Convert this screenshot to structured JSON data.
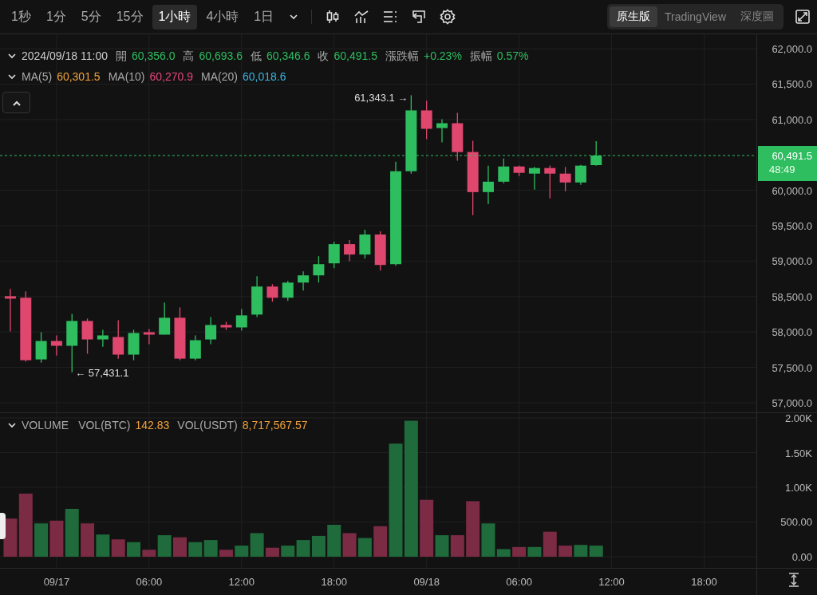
{
  "toolbar": {
    "intervals": [
      {
        "label": "1秒",
        "selected": false
      },
      {
        "label": "1分",
        "selected": false
      },
      {
        "label": "5分",
        "selected": false
      },
      {
        "label": "15分",
        "selected": false
      },
      {
        "label": "1小時",
        "selected": true
      },
      {
        "label": "4小時",
        "selected": false
      },
      {
        "label": "1日",
        "selected": false
      }
    ],
    "views": [
      {
        "label": "原生版",
        "selected": true
      },
      {
        "label": "TradingView",
        "selected": false
      },
      {
        "label": "深度圖",
        "selected": false
      }
    ]
  },
  "legend": {
    "time": "2024/09/18 11:00",
    "fields": [
      {
        "label": "開",
        "value": "60,356.0"
      },
      {
        "label": "高",
        "value": "60,693.6"
      },
      {
        "label": "低",
        "value": "60,346.6"
      },
      {
        "label": "收",
        "value": "60,491.5"
      },
      {
        "label": "漲跌幅",
        "value": "+0.23%"
      },
      {
        "label": "振幅",
        "value": "0.57%"
      }
    ],
    "ma": [
      {
        "label": "MA(5)",
        "value": "60,301.5",
        "color": "#f2a23c"
      },
      {
        "label": "MA(10)",
        "value": "60,270.9",
        "color": "#e4477e"
      },
      {
        "label": "MA(20)",
        "value": "60,018.6",
        "color": "#3cb4e0"
      }
    ]
  },
  "price_chart": {
    "countdown": "48:49",
    "chart_data": {
      "type": "candlestick",
      "grid": true,
      "categories": [
        null,
        null,
        null,
        null,
        null,
        null,
        null,
        null,
        null,
        null,
        null,
        null,
        null,
        null,
        null,
        null,
        null,
        null,
        null,
        null,
        null,
        null,
        null,
        null,
        null,
        null,
        null,
        null,
        null,
        null,
        null,
        null,
        null,
        null,
        null,
        null,
        null,
        null,
        null,
        null,
        null,
        null,
        null,
        null,
        null,
        null,
        null,
        null
      ],
      "ohlc": [
        [
          58505,
          58607,
          58007,
          58470
        ],
        [
          58483,
          58573,
          57578,
          57600
        ],
        [
          57612,
          57996,
          57566,
          57872
        ],
        [
          57872,
          57951,
          57668,
          57804
        ],
        [
          57804,
          58256,
          57431.1,
          58155
        ],
        [
          58155,
          58189,
          57691,
          57894
        ],
        [
          57894,
          58030,
          57792,
          57951
        ],
        [
          57928,
          58166,
          57623,
          57680
        ],
        [
          57680,
          58030,
          57600,
          57985
        ],
        [
          57996,
          58042,
          57826,
          57962
        ],
        [
          57962,
          58415,
          57962,
          58200
        ],
        [
          58200,
          58347,
          57600,
          57623
        ],
        [
          57623,
          57951,
          57600,
          57883
        ],
        [
          57894,
          58211,
          57826,
          58098
        ],
        [
          58098,
          58143,
          58030,
          58064
        ],
        [
          58064,
          58324,
          58020,
          58234
        ],
        [
          58245,
          58788,
          58211,
          58641
        ],
        [
          58641,
          58675,
          58427,
          58483
        ],
        [
          58483,
          58720,
          58438,
          58697
        ],
        [
          58697,
          58856,
          58585,
          58799
        ],
        [
          58799,
          59070,
          58697,
          58957
        ],
        [
          58969,
          59274,
          58900,
          59240
        ],
        [
          59240,
          59297,
          59000,
          59093
        ],
        [
          59093,
          59444,
          59036,
          59376
        ],
        [
          59376,
          59421,
          58867,
          58946
        ],
        [
          58957,
          60405,
          58935,
          60270
        ],
        [
          60270,
          61343.1,
          60235,
          61129
        ],
        [
          61129,
          61265,
          60722,
          60869
        ],
        [
          60880,
          61005,
          60677,
          60948
        ],
        [
          60948,
          61095,
          60417,
          60541
        ],
        [
          60541,
          60700,
          59650,
          59975
        ],
        [
          59975,
          60349,
          59805,
          60122
        ],
        [
          60122,
          60450,
          60100,
          60337
        ],
        [
          60337,
          60350,
          60200,
          60247
        ],
        [
          60236,
          60330,
          60009,
          60315
        ],
        [
          60315,
          60350,
          59885,
          60236
        ],
        [
          60236,
          60330,
          59987,
          60111
        ],
        [
          60111,
          60360,
          60078,
          60349
        ],
        [
          60356,
          60693.6,
          60346.6,
          60491.5
        ],
        null,
        null,
        null,
        null,
        null,
        null,
        null,
        null,
        null
      ],
      "ylim": [
        56864,
        62204
      ],
      "yticks": [
        {
          "value": 62000,
          "label": "62,000.0"
        },
        {
          "value": 61500,
          "label": "61,500.0"
        },
        {
          "value": 61000,
          "label": "61,000.0"
        },
        {
          "value": 60000,
          "label": "60,000.0"
        },
        {
          "value": 59500,
          "label": "59,500.0"
        },
        {
          "value": 59000,
          "label": "59,000.0"
        },
        {
          "value": 58500,
          "label": "58,500.0"
        },
        {
          "value": 58000,
          "label": "58,000.0"
        },
        {
          "value": 57500,
          "label": "57,500.0"
        },
        {
          "value": 57000,
          "label": "57,000.0"
        }
      ],
      "annotations": [
        "61,343.1 →",
        "← 57,431.1"
      ],
      "ref_lines": [
        {
          "axis": "y",
          "value": 60491.5,
          "label": "60,491.5"
        }
      ]
    }
  },
  "volume": {
    "title": "VOLUME",
    "fields": [
      {
        "label": "VOL(BTC)",
        "value": "142.83"
      },
      {
        "label": "VOL(USDT)",
        "value": "8,717,567.57"
      }
    ],
    "chart_data": {
      "type": "bar",
      "grid": true,
      "categories": [
        null,
        null,
        null,
        "09/17",
        null,
        null,
        null,
        null,
        null,
        "06:00",
        null,
        null,
        null,
        null,
        null,
        "12:00",
        null,
        null,
        null,
        null,
        null,
        "18:00",
        null,
        null,
        null,
        null,
        null,
        "09/18",
        null,
        null,
        null,
        null,
        null,
        "06:00",
        null,
        null,
        null,
        null,
        null,
        "12:00",
        null,
        null,
        null,
        null,
        null,
        "18:00",
        null,
        null
      ],
      "values": [
        550,
        910,
        480,
        520,
        690,
        480,
        320,
        250,
        210,
        100,
        310,
        280,
        210,
        240,
        100,
        160,
        340,
        130,
        160,
        240,
        300,
        460,
        340,
        270,
        440,
        1630,
        1960,
        820,
        310,
        310,
        800,
        480,
        110,
        140,
        140,
        360,
        160,
        170,
        160,
        null,
        null,
        null,
        null,
        null,
        null,
        null,
        null,
        null
      ],
      "ylim": [
        -161,
        2069
      ],
      "yticks": [
        {
          "value": 0,
          "label": "0.00"
        },
        {
          "value": 500,
          "label": "500.00"
        },
        {
          "value": 1000,
          "label": "1.00K"
        },
        {
          "value": 1500,
          "label": "1.50K"
        },
        {
          "value": 2000,
          "label": "2.00K"
        }
      ]
    }
  }
}
